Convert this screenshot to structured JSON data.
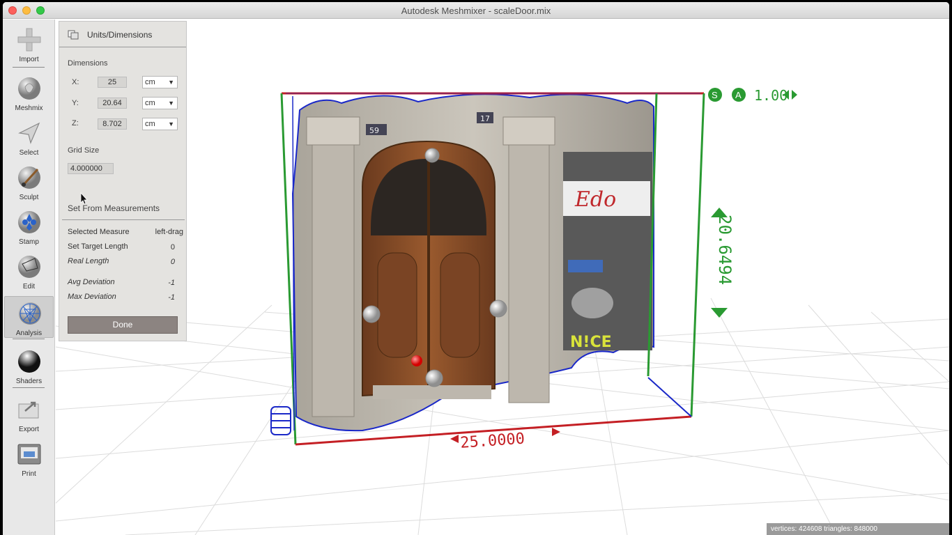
{
  "window": {
    "title": "Autodesk Meshmixer - scaleDoor.mix"
  },
  "toolbar": {
    "items": [
      {
        "label": "Import",
        "icon": "plus-icon"
      },
      {
        "label": "Meshmix",
        "icon": "meshmix-bunny-icon"
      },
      {
        "label": "Select",
        "icon": "arrow-cursor-icon"
      },
      {
        "label": "Sculpt",
        "icon": "brush-icon"
      },
      {
        "label": "Stamp",
        "icon": "stamp-icon"
      },
      {
        "label": "Edit",
        "icon": "edit-sphere-icon"
      },
      {
        "label": "Analysis",
        "icon": "analysis-mesh-icon",
        "active": true
      },
      {
        "label": "Shaders",
        "icon": "shader-sphere-icon"
      },
      {
        "label": "Export",
        "icon": "export-icon"
      },
      {
        "label": "Print",
        "icon": "printer-icon"
      }
    ]
  },
  "panel": {
    "title": "Units/Dimensions",
    "dimensions_label": "Dimensions",
    "x_label": "X:",
    "x_value": "25",
    "x_unit": "cm",
    "y_label": "Y:",
    "y_value": "20.64",
    "y_unit": "cm",
    "z_label": "Z:",
    "z_value": "8.702",
    "z_unit": "cm",
    "grid_label": "Grid Size",
    "grid_value": "4.000000",
    "measure_section": "Set From Measurements",
    "rows": [
      {
        "label": "Selected Measure",
        "value": "left-drag",
        "italic": false
      },
      {
        "label": "Set Target Length",
        "value": "0",
        "italic": false
      },
      {
        "label": "Real Length",
        "value": "0",
        "italic": true
      },
      {
        "label": "Avg Deviation",
        "value": "-1",
        "italic": true
      },
      {
        "label": "Max Deviation",
        "value": "-1",
        "italic": true
      }
    ],
    "done_label": "Done"
  },
  "viewport": {
    "scale_s": "S",
    "scale_a": "A",
    "scale_value": "1.00",
    "dim_width": "25.0000",
    "dim_height": "20.6494",
    "sign_text": "Edo",
    "graffiti_text": "N!CE",
    "house_num_left": "59",
    "house_num_right": "17"
  },
  "status": {
    "text": "vertices: 424608 triangles: 848000"
  },
  "colors": {
    "bbox_red": "#c41f24",
    "bbox_green": "#2a9a32",
    "mesh_outline": "#1a28c8",
    "accent_done": "#8c8481"
  }
}
